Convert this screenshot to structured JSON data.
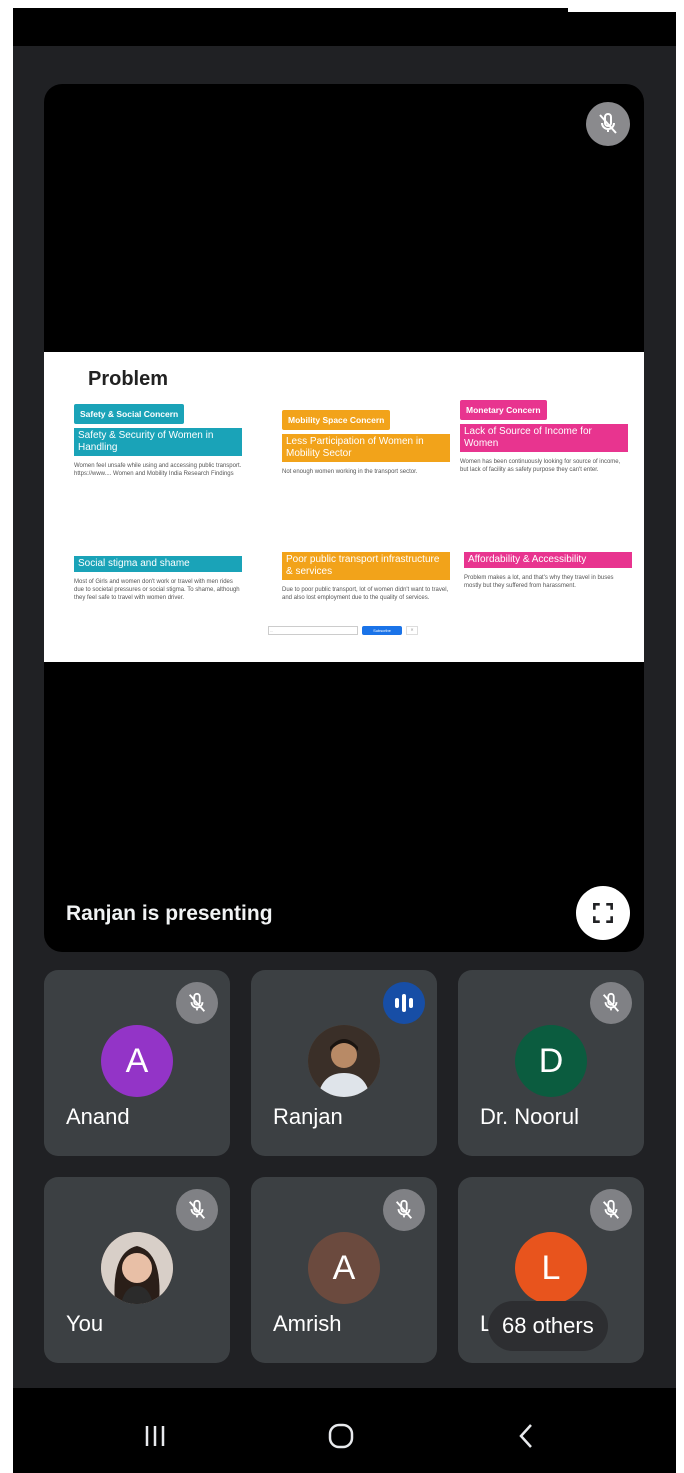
{
  "stage": {
    "presenting_label": "Ranjan is presenting",
    "mute_icon": "mic-off-icon",
    "fullscreen_icon": "fullscreen-icon"
  },
  "slide": {
    "title": "Problem",
    "columns": [
      {
        "heading": "Safety & Social Concern",
        "color": "#1aa3b8",
        "items": [
          {
            "subtitle": "Safety & Security of Women in Handling",
            "text": "Women feel unsafe while using and accessing public transport. https://www.... Women and Mobility India Research Findings"
          },
          {
            "subtitle": "Social stigma and shame",
            "text": "Most of Girls and women don't work or travel with men rides due to societal pressures or social stigma. To shame, although they feel safe to travel with women driver."
          }
        ]
      },
      {
        "heading": "Mobility Space Concern",
        "color": "#f2a31a",
        "items": [
          {
            "subtitle": "Less Participation of Women in Mobility Sector",
            "text": "Not enough women working in the transport sector."
          },
          {
            "subtitle": "Poor public transport infrastructure & services",
            "text": "Due to poor public transport, lot of women didn't want to travel, and also lost employment due to the quality of services."
          }
        ]
      },
      {
        "heading": "Monetary Concern",
        "color": "#e8348f",
        "items": [
          {
            "subtitle": "Lack of Source of Income for Women",
            "text": "Women has been continuously looking for source of income, but lack of facility as safety purpose they can't enter."
          },
          {
            "subtitle": "Affordability & Accessibility",
            "text": "Problem makes a lot, and that's why they travel in buses mostly but they suffered from harassment."
          }
        ]
      }
    ],
    "footer": {
      "field": "...",
      "button": "Subscribe",
      "close": "✕"
    }
  },
  "participants": [
    {
      "name": "Anand",
      "initial": "A",
      "avatar_color": "#9334c7",
      "status_icon": "mic-off-icon",
      "speaking": false,
      "photo": false
    },
    {
      "name": "Ranjan",
      "initial": "",
      "avatar_color": "#6b5a4a",
      "status_icon": "audio-level-icon",
      "speaking": true,
      "photo": true
    },
    {
      "name": "Dr. Noorul",
      "initial": "D",
      "avatar_color": "#0b5c3f",
      "status_icon": "mic-off-icon",
      "speaking": false,
      "photo": false
    },
    {
      "name": "You",
      "initial": "",
      "avatar_color": "#8a6d60",
      "status_icon": "mic-off-icon",
      "speaking": false,
      "photo": true
    },
    {
      "name": "Amrish",
      "initial": "A",
      "avatar_color": "#6b4a3e",
      "status_icon": "mic-off-icon",
      "speaking": false,
      "photo": false
    },
    {
      "name": "L",
      "initial": "L",
      "avatar_color": "#e8541d",
      "status_icon": "mic-off-icon",
      "speaking": false,
      "photo": false
    }
  ],
  "others_label": "68 others",
  "navbar": {
    "recents_icon": "recents-icon",
    "home_icon": "home-icon",
    "back_icon": "back-icon"
  }
}
